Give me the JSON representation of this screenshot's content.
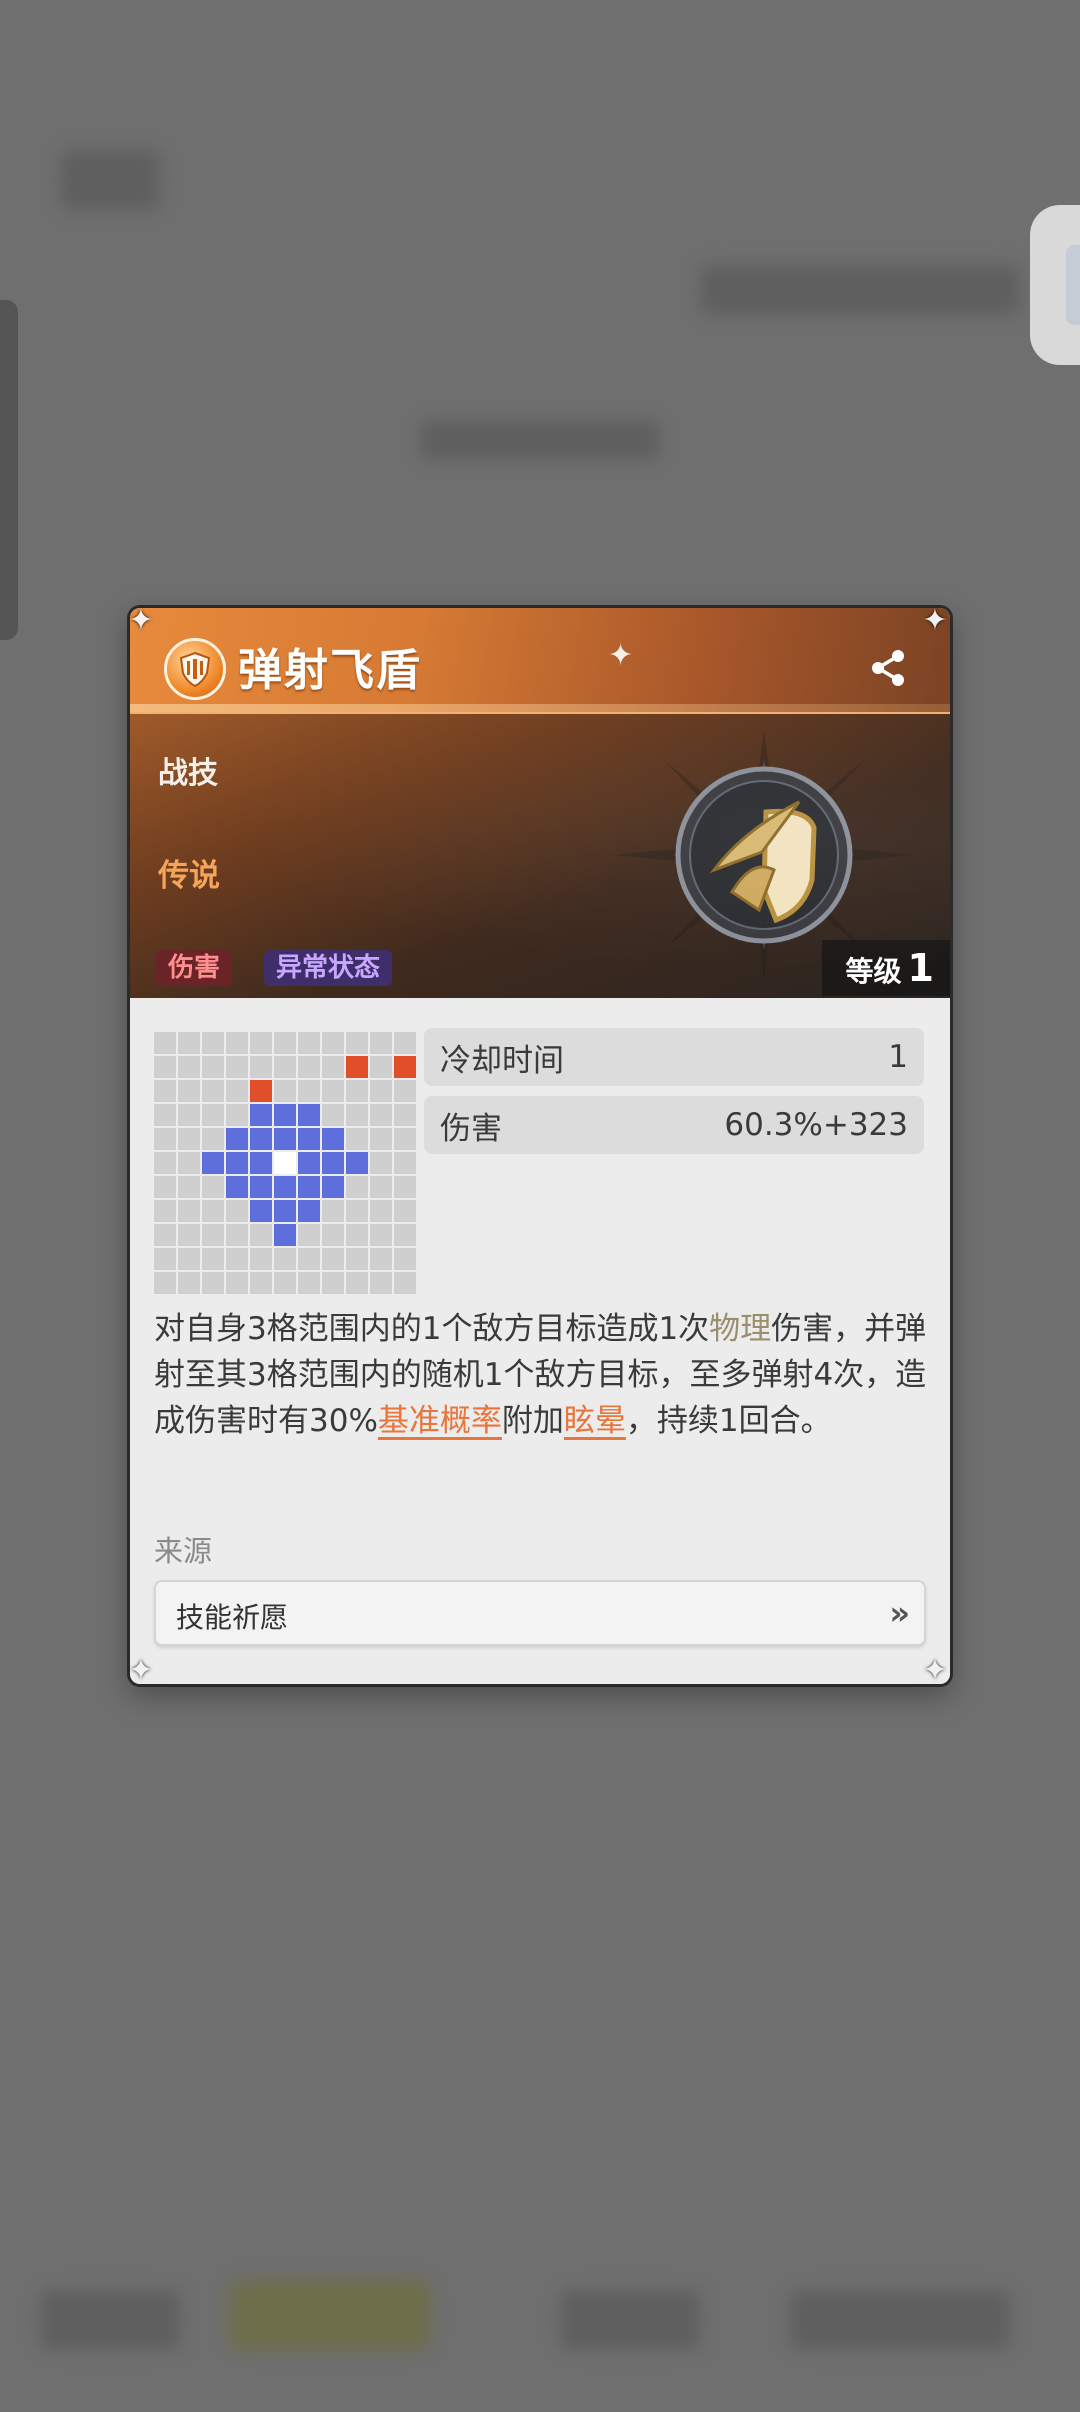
{
  "skill": {
    "name": "弹射飞盾",
    "type": "战技",
    "rarity": "传说",
    "tags": [
      "伤害",
      "异常状态"
    ],
    "level_label": "等级",
    "level": "1"
  },
  "stats": [
    {
      "key": "冷却时间",
      "value": "1"
    },
    {
      "key": "伤害",
      "value": "60.3%+323"
    }
  ],
  "description": {
    "p1": "对自身3格范围内的1个敌方目标造成1次",
    "phys": "物理",
    "p2": "伤害，并弹射至其3格范围内的随机1个敌方目标，至多弹射4次，造成伤害时有30%",
    "link1": "基准概率",
    "p3": "附加",
    "link2": "眩晕",
    "p4": "，持续1回合。"
  },
  "source": {
    "label": "来源",
    "button": "技能祈愿",
    "arrow": "»"
  },
  "range_grid": {
    "cols": 11,
    "rows": 11,
    "rows_pattern": [
      "...........",
      "........e.e",
      "....e......",
      "....bbb....",
      "...bbbbb...",
      "..bbbwbbb..",
      "...bbbbb...",
      "....bbb....",
      ".....b.....",
      "...........",
      "..........."
    ]
  },
  "colors": {
    "accent_orange": "#e78a3c",
    "enemy": "#e14f2a",
    "range": "#5e6fdc",
    "tag_damage": "#ff8e8e",
    "tag_status": "#c9a6ff",
    "rarity": "#f6a45a"
  },
  "icons": {
    "skill": "shield-emblem-icon",
    "share": "share-icon",
    "source_arrow": "double-chevron-right-icon"
  }
}
